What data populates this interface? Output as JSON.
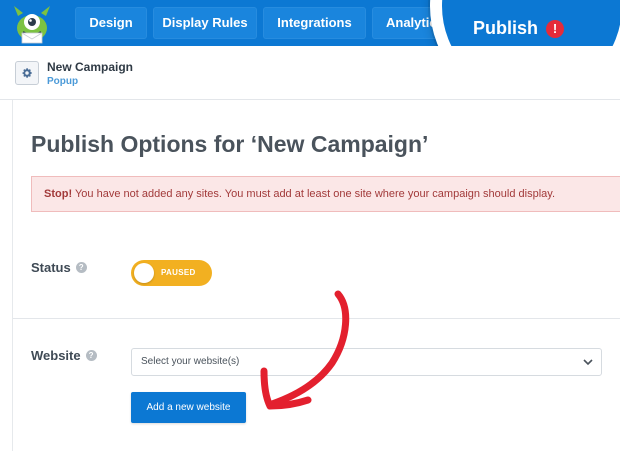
{
  "nav": {
    "tabs": [
      {
        "label": "Design"
      },
      {
        "label": "Display Rules"
      },
      {
        "label": "Integrations"
      },
      {
        "label": "Analytics"
      }
    ],
    "publish_label": "Publish",
    "publish_alert": "!"
  },
  "campaign": {
    "name": "New Campaign",
    "type": "Popup"
  },
  "page": {
    "title": "Publish Options for ‘New Campaign’",
    "alert_strong": "Stop!",
    "alert_text": " You have not added any sites. You must add at least one site where your campaign should display."
  },
  "status": {
    "label": "Status",
    "toggle_text": "PAUSED"
  },
  "website": {
    "label": "Website",
    "select_placeholder": "Select your website(s)",
    "add_button": "Add a new website"
  },
  "colors": {
    "brand_blue": "#0c78d3",
    "toggle_paused": "#f2b021",
    "alert_red": "#e52b3a",
    "annotation_arrow": "#e3202e"
  }
}
